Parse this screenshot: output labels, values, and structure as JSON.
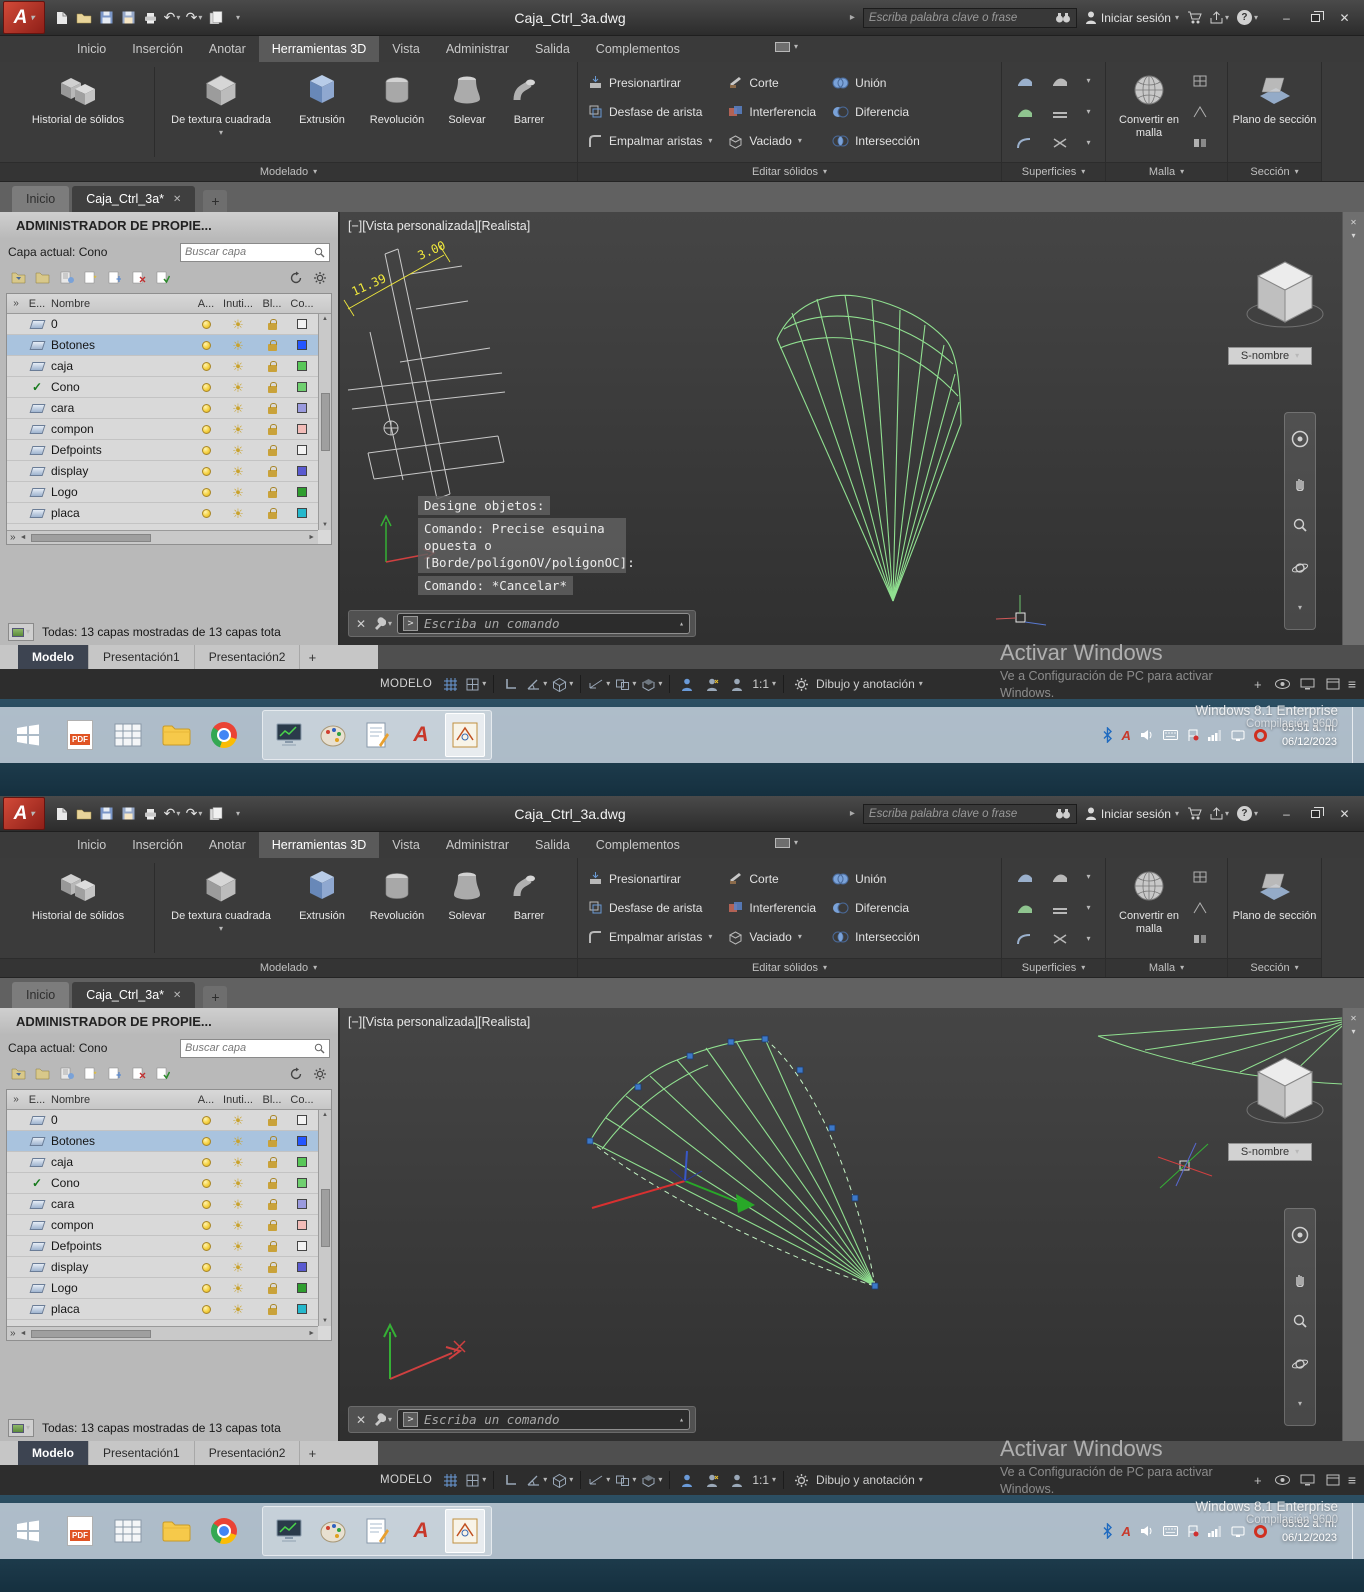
{
  "colors": {
    "autocad_logo_red": "#c03a2b",
    "wireframe_green": "#90e090",
    "dimension_yellow": "#f0e83c",
    "selection_blue": "#a9c3de",
    "grip_blue": "#3c78c8",
    "taskbar_blue_gray": "#bac7d3"
  },
  "icons": {
    "dropdown": "▾",
    "up_caret": "▴",
    "right_caret": "▸",
    "close": "✕",
    "minimize": "–",
    "chevrons": "»",
    "sun": "☀",
    "check": "✓",
    "plus": "+",
    "undo": "↶",
    "redo": "↷",
    "menu": "≡",
    "scroll_up": "▲",
    "scroll_down": "▼",
    "scroll_left": "◄",
    "scroll_right": "►",
    "question": "?",
    "prompt": ">"
  },
  "titlebar": {
    "doc_title": "Caja_Ctrl_3a.dwg",
    "search_placeholder": "Escriba palabra clave o frase",
    "signin_label": "Iniciar sesión",
    "logo_letter": "A"
  },
  "ribbon_tabs": {
    "inicio": "Inicio",
    "insercion": "Inserción",
    "anotar": "Anotar",
    "herramientas3d": "Herramientas 3D",
    "vista": "Vista",
    "administrar": "Administrar",
    "salida": "Salida",
    "complementos": "Complementos"
  },
  "modelado": {
    "title": "Modelado",
    "historial": "Historial de sólidos",
    "textura": "De textura cuadrada",
    "extrusion": "Extrusión",
    "revolucion": "Revolución",
    "solevar": "Solevar",
    "barrer": "Barrer"
  },
  "editar": {
    "title": "Editar sólidos",
    "presionartirar": "Presionartirar",
    "desfase": "Desfase de arista",
    "empalmar": "Empalmar aristas",
    "corte": "Corte",
    "interferencia": "Interferencia",
    "vaciado": "Vaciado",
    "union": "Unión",
    "diferencia": "Diferencia",
    "interseccion": "Intersección"
  },
  "superficies": {
    "title": "Superficies"
  },
  "malla": {
    "title": "Malla",
    "convertir": "Convertir en malla"
  },
  "seccion": {
    "title": "Sección",
    "plano": "Plano de sección"
  },
  "doc_tabs": {
    "inicio": "Inicio",
    "drawing": "Caja_Ctrl_3a*"
  },
  "palette": {
    "title": "ADMINISTRADOR DE PROPIE...",
    "current_layer": "Capa actual: Cono",
    "search_placeholder": "Buscar capa",
    "columns": {
      "estado": "E...",
      "nombre": "Nombre",
      "activar": "A...",
      "inutilizar": "Inuti...",
      "bloquear": "Bl...",
      "color": "Co..."
    },
    "rows": [
      {
        "name": "0",
        "color": "#f2f2f2"
      },
      {
        "name": "Botones",
        "color": "#2456ff"
      },
      {
        "name": "caja",
        "color": "#58c758"
      },
      {
        "name": "Cono",
        "color": "#6fcf6f"
      },
      {
        "name": "cara",
        "color": "#9a9ade"
      },
      {
        "name": "compon",
        "color": "#f2bcb8"
      },
      {
        "name": "Defpoints",
        "color": "#f2f2f2"
      },
      {
        "name": "display",
        "color": "#5a5ad0"
      },
      {
        "name": "Logo",
        "color": "#2f9e2f"
      },
      {
        "name": "placa",
        "color": "#25b8cc"
      }
    ],
    "footer": "Todas: 13 capas mostradas de 13 capas tota"
  },
  "viewport": {
    "header": "[−][Vista personalizada][Realista]",
    "dim_a": "3.00",
    "dim_b": "11.39",
    "snombre": "S-nombre",
    "history_1": "Designe objetos:",
    "history_2": "Comando: Precise esquina opuesta o [Borde/polígonOV/polígonOC]:",
    "history_3": "Comando: *Cancelar*",
    "command_placeholder": "Escriba un comando"
  },
  "model_tabs": {
    "modelo": "Modelo",
    "pres1": "Presentación1",
    "pres2": "Presentación2"
  },
  "statusbar": {
    "modelo": "MODELO",
    "scale": "1:1",
    "workspace": "Dibujo y anotación"
  },
  "watermark": {
    "line1": "Activar Windows",
    "line2": "Ve a Configuración de PC para activar",
    "line3": "Windows."
  },
  "desktop": {
    "os_watermark": "Windows 8.1 Enterprise",
    "os_build": "Compilación 9600"
  },
  "taskbar": {
    "pdf_label": "PDF"
  },
  "screens": [
    {
      "time": "05:51 a. m.",
      "date": "06/12/2023"
    },
    {
      "time": "05:52 a. m.",
      "date": "06/12/2023"
    }
  ]
}
